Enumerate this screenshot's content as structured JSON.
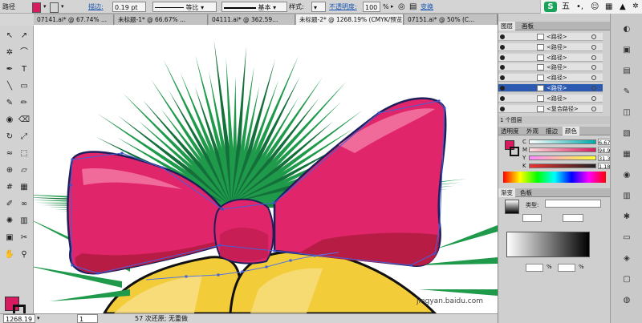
{
  "control_bar": {
    "object_type": "路径",
    "stroke_label": "描边:",
    "stroke_weight": "0.19 pt",
    "profile_label": "等比",
    "brush_label": "基本",
    "style_label": "样式:",
    "opacity_label": "不透明度:",
    "opacity_value": "100",
    "opacity_unit": "%",
    "transform_link": "变换",
    "fill_color": "#d81b60",
    "stroke_color": "#111111"
  },
  "ime_bar": {
    "logo": "S",
    "mode": "五",
    "punct": "•,",
    "smile": "☺",
    "grid": "▦",
    "shirt": "▲"
  },
  "tabs": [
    {
      "label": "07141.ai* @ 67.74% ..."
    },
    {
      "label": "未标题-1* @ 66.67% ..."
    },
    {
      "label": "04111.ai* @ 362.59..."
    },
    {
      "label": "未标题-2* @ 1268.19% (CMYK/预览)"
    },
    {
      "label": "07151.ai* @ 50% (C..."
    }
  ],
  "status_bar": {
    "zoom": "1268.19",
    "page": "1",
    "info": "57 次还原; 无重做"
  },
  "layers_panel": {
    "tab_layers": "图层",
    "tab_links": "画板",
    "rows": [
      {
        "label": "<路径>"
      },
      {
        "label": "<路径>"
      },
      {
        "label": "<路径>"
      },
      {
        "label": "<路径>"
      },
      {
        "label": "<路径>"
      },
      {
        "label": "<路径>"
      },
      {
        "label": "<路径>"
      },
      {
        "label": "<复合路径>"
      }
    ],
    "footer": "1 个图层"
  },
  "color_panel": {
    "tabs": [
      "透明度",
      "外观",
      "描边",
      "颜色"
    ],
    "channels": [
      {
        "label": "C",
        "value": "6.67"
      },
      {
        "label": "M",
        "value": "94.9"
      },
      {
        "label": "Y",
        "value": "31.37"
      },
      {
        "label": "K",
        "value": "1.18"
      }
    ]
  },
  "gradient_panel": {
    "tabs": [
      "渐变",
      "色板"
    ],
    "type_label": "类型:",
    "percent_sign": "%"
  },
  "watermark": "jingyan.baidu.com",
  "tools": [
    "selection-tool",
    "direct-selection-tool",
    "magic-wand-tool",
    "lasso-tool",
    "pen-tool",
    "type-tool",
    "line-tool",
    "rectangle-tool",
    "paintbrush-tool",
    "pencil-tool",
    "blob-brush-tool",
    "eraser-tool",
    "rotate-tool",
    "scale-tool",
    "warp-tool",
    "free-transform-tool",
    "shape-builder-tool",
    "perspective-tool",
    "mesh-tool",
    "gradient-tool",
    "eyedropper-tool",
    "blend-tool",
    "symbol-sprayer-tool",
    "column-graph-tool",
    "artboard-tool",
    "slice-tool",
    "hand-tool",
    "zoom-tool"
  ]
}
